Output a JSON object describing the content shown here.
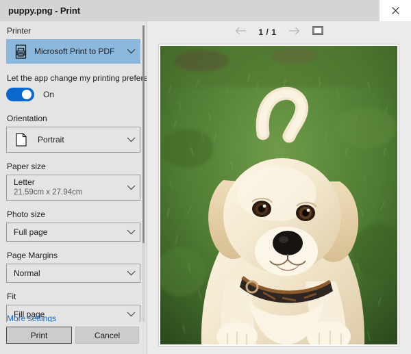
{
  "window": {
    "title": "puppy.png - Print",
    "close_icon": "close-icon"
  },
  "settings": {
    "printer": {
      "label": "Printer",
      "value": "Microsoft Print to PDF",
      "icon": "printer-icon",
      "chevron": "chevron-down-icon"
    },
    "app_preferences": {
      "label": "Let the app change my printing preferences",
      "state": "On"
    },
    "orientation": {
      "label": "Orientation",
      "value": "Portrait",
      "icon": "page-portrait-icon"
    },
    "paper_size": {
      "label": "Paper size",
      "value": "Letter",
      "dimensions": "21.59cm x 27.94cm"
    },
    "photo_size": {
      "label": "Photo size",
      "value": "Full page"
    },
    "page_margins": {
      "label": "Page Margins",
      "value": "Normal"
    },
    "fit": {
      "label": "Fit",
      "value": "Fill page"
    },
    "more_settings_link": "More settings"
  },
  "actions": {
    "print_label": "Print",
    "cancel_label": "Cancel"
  },
  "preview": {
    "prev_icon": "arrow-left-icon",
    "next_icon": "arrow-right-icon",
    "page_indicator": "1 / 1",
    "fit_icon": "fit-to-page-icon",
    "image_alt": "puppy.png"
  },
  "colors": {
    "accent": "#0a68cc",
    "combo_selected": "#8cb8dd",
    "link": "#1266c4",
    "titlebar": "#d4d4d4",
    "pane": "#e4e4e4"
  }
}
